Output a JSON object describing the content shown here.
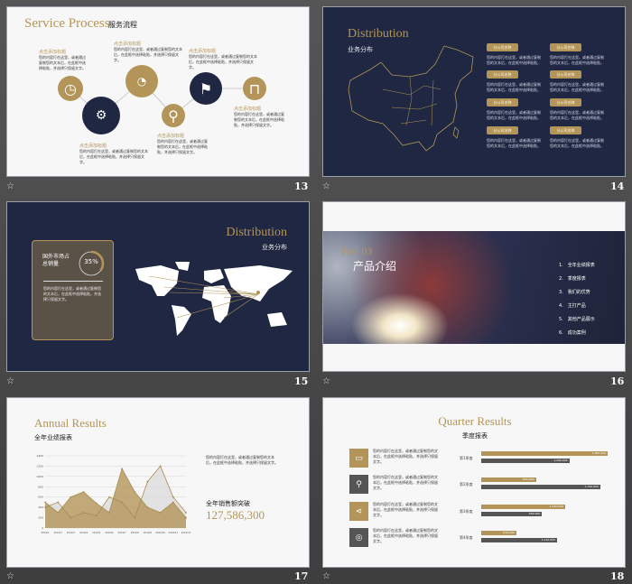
{
  "colors": {
    "gold": "#b39559",
    "navy": "#1f2742",
    "gray": "#555555",
    "background": "#4a4a4a"
  },
  "placeholder": {
    "title": "点击添加标题",
    "body": "您的内容打在这里，或者通过复制您的文本后，在此框中选择粘贴，并选择只保留文字。"
  },
  "slides": [
    {
      "number": "13",
      "title": "Service Process",
      "subtitle": "服务流程",
      "icons": [
        "clock-icon",
        "gear-icon",
        "pie-chart-icon",
        "location-pin-icon",
        "flag-icon",
        "shopping-bag-icon"
      ]
    },
    {
      "number": "14",
      "title": "Distribution",
      "subtitle": "业务分布",
      "branch_label": "分公司名称",
      "branch_count": 8
    },
    {
      "number": "15",
      "title": "Distribution",
      "subtitle": "业务分布",
      "stat_label": "国外市场占总销量",
      "stat_value": "35%",
      "stat_fraction": 0.35
    },
    {
      "number": "16",
      "part": "Part 03",
      "title": "产品介绍",
      "items": [
        "全年业绩报表",
        "季度报表",
        "我们的优势",
        "主打产品",
        "其他产品展示",
        "成功案例"
      ]
    },
    {
      "number": "17",
      "title": "Annual Results",
      "subtitle": "全年业绩报表",
      "total_label": "全年销售额突破",
      "total_value": "127,586,300"
    },
    {
      "number": "18",
      "title": "Quarter Results",
      "subtitle": "季度报表",
      "quarters": [
        "第1季度",
        "第2季度",
        "第3季度",
        "第4季度"
      ],
      "icons": [
        "briefcase-icon",
        "search-icon",
        "share-icon",
        "gear-icon"
      ]
    }
  ],
  "chart_data": [
    {
      "type": "area",
      "x": [
        "2019/1",
        "2019/2",
        "2019/3",
        "2019/4",
        "2019/5",
        "2019/6",
        "2019/7",
        "2019/8",
        "2019/9",
        "2019/10",
        "2019/11",
        "2019/12"
      ],
      "yticks": [
        "0",
        "200",
        "400",
        "600",
        "800",
        "1000",
        "1200",
        "1400"
      ],
      "ylim": [
        0,
        1400
      ],
      "grid": true,
      "series": [
        {
          "values": [
            500,
            300,
            600,
            700,
            480,
            300,
            1150,
            700,
            400,
            300,
            500,
            200
          ],
          "color": "#b39559"
        },
        {
          "values": [
            400,
            500,
            200,
            300,
            240,
            600,
            500,
            200,
            900,
            1200,
            600,
            300
          ],
          "color": "#d8d8d8"
        }
      ]
    },
    {
      "type": "bar",
      "orientation": "horizontal",
      "categories": [
        "第1季度",
        "第2季度",
        "第3季度",
        "第4季度"
      ],
      "series": [
        {
          "values": [
            1850445,
            800000,
            1230000,
            510000
          ],
          "labels": [
            "1,850,445",
            "800,000",
            "1,230,000",
            "510,000"
          ],
          "color": "#b39559"
        },
        {
          "values": [
            1290000,
            1740000,
            890000,
            1110000
          ],
          "labels": [
            "1,290,000",
            "1,740,000",
            "890,000",
            "1,110,000"
          ],
          "color": "#555555"
        }
      ]
    }
  ]
}
